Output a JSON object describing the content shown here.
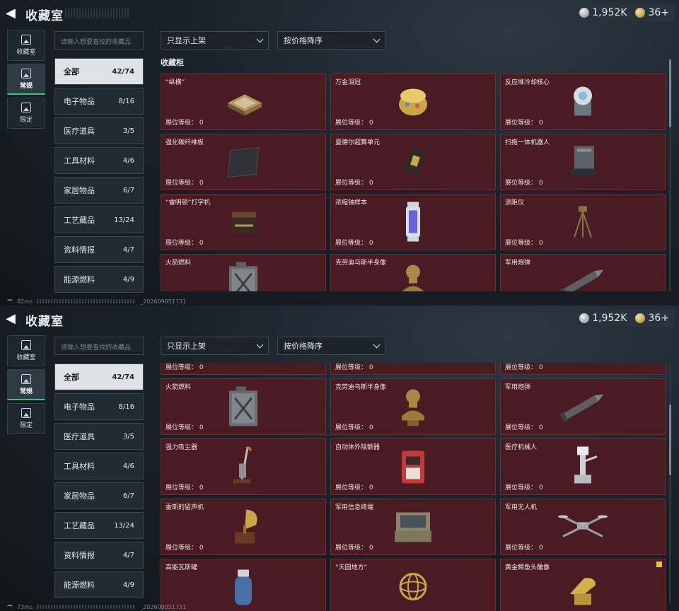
{
  "header": {
    "title": "收藏室",
    "silver_amount": "1,952K",
    "gold_amount": "36+"
  },
  "side_nav": [
    {
      "label": "收藏室",
      "icon": "collection-room-icon"
    },
    {
      "label": "常规",
      "icon": "regular-icon"
    },
    {
      "label": "限定",
      "icon": "limited-icon"
    }
  ],
  "search": {
    "placeholder": "请输入想要查找的收藏品"
  },
  "filters": {
    "shelf_filter": "只显示上架",
    "sort": "按价格降序"
  },
  "categories": [
    {
      "name": "全部",
      "count": "42/74"
    },
    {
      "name": "电子物品",
      "count": "8/16"
    },
    {
      "name": "医疗道具",
      "count": "3/5"
    },
    {
      "name": "工具材料",
      "count": "4/6"
    },
    {
      "name": "家居物品",
      "count": "6/7"
    },
    {
      "name": "工艺藏品",
      "count": "13/24"
    },
    {
      "name": "资料情报",
      "count": "4/7"
    },
    {
      "name": "能源燃料",
      "count": "4/9"
    }
  ],
  "section_title": "收藏柜",
  "level_label": "展位等级：",
  "top_items": [
    {
      "name": "“纵横”",
      "level": "0",
      "icon": "chess-board-icon"
    },
    {
      "name": "万金泪冠",
      "level": "0",
      "icon": "jeweled-egg-icon"
    },
    {
      "name": "反应堆冷却核心",
      "level": "0",
      "icon": "reactor-core-icon"
    },
    {
      "name": "强化碳纤维板",
      "level": "0",
      "icon": "carbon-plate-icon"
    },
    {
      "name": "曼德尔超算单元",
      "level": "0",
      "icon": "supercomputer-unit-icon"
    },
    {
      "name": "扫拖一体机器人",
      "level": "0",
      "icon": "robot-vacuum-icon"
    },
    {
      "name": "“雷明顿”打字机",
      "level": "0",
      "icon": "typewriter-icon"
    },
    {
      "name": "浓缩铀样本",
      "level": "0",
      "icon": "uranium-sample-icon"
    },
    {
      "name": "测距仪",
      "level": "0",
      "icon": "rangefinder-icon"
    },
    {
      "name": "火箭燃料",
      "level": "0",
      "icon": "fuel-canister-icon"
    },
    {
      "name": "克劳迪乌斯半身像",
      "level": "0",
      "icon": "bust-icon"
    },
    {
      "name": "军用炮弹",
      "level": "0",
      "icon": "artillery-shell-icon"
    }
  ],
  "bottom_items": [
    {
      "name": "",
      "level": "0",
      "icon": "partial-item-icon"
    },
    {
      "name": "",
      "level": "0",
      "icon": "partial-item-icon"
    },
    {
      "name": "",
      "level": "0",
      "icon": "partial-item-icon"
    },
    {
      "name": "火箭燃料",
      "level": "0",
      "icon": "fuel-canister-icon"
    },
    {
      "name": "克劳迪乌斯半身像",
      "level": "0",
      "icon": "bust-icon"
    },
    {
      "name": "军用炮弹",
      "level": "0",
      "icon": "artillery-shell-icon"
    },
    {
      "name": "强力吸尘器",
      "level": "0",
      "icon": "vacuum-cleaner-icon"
    },
    {
      "name": "自动体外除颤器",
      "level": "0",
      "icon": "defibrillator-icon"
    },
    {
      "name": "医疗机械人",
      "level": "0",
      "icon": "medical-robot-icon"
    },
    {
      "name": "雷斯的留声机",
      "level": "0",
      "icon": "gramophone-icon"
    },
    {
      "name": "军用信息终端",
      "level": "0",
      "icon": "military-terminal-icon"
    },
    {
      "name": "军用无人机",
      "level": "0",
      "icon": "drone-icon"
    },
    {
      "name": "高能瓦斯罐",
      "level": "",
      "icon": "gas-tank-icon"
    },
    {
      "name": "“天圆地方”",
      "level": "",
      "icon": "armillary-sphere-icon"
    },
    {
      "name": "黄金鳄鱼头雕像",
      "level": "",
      "icon": "gold-crocodile-icon",
      "badge": true
    }
  ],
  "status_top": {
    "ping": "82ms",
    "build": "_202609051731"
  },
  "status_bottom": {
    "ping": "73ms",
    "build": "_202609051731"
  }
}
